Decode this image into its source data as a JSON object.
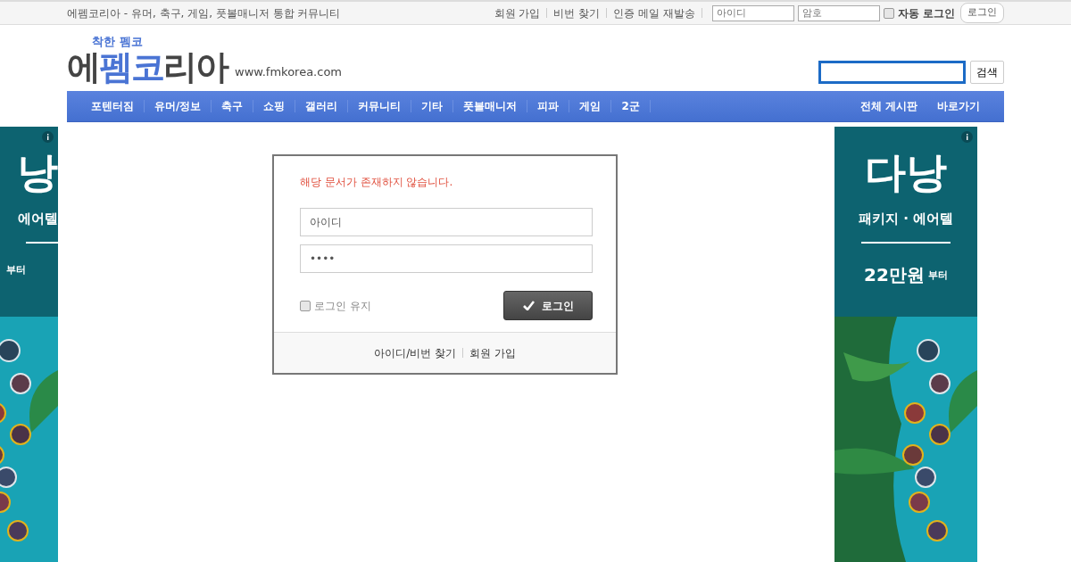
{
  "top_bar": {
    "description": "에펨코리아 - 유머, 축구, 게임, 풋볼매니저 통합 커뮤니티",
    "links": [
      "회원 가입",
      "비번 찾기",
      "인증 메일 재발송"
    ],
    "id_field": {
      "placeholder": "아이디"
    },
    "password_field": {
      "placeholder": "암호"
    },
    "auto_login": {
      "label": "자동 로그인",
      "checked": false
    },
    "login_button": "로그인"
  },
  "logo": {
    "tagline": "착한 펨코",
    "name": [
      {
        "text": "에",
        "highlight": false
      },
      {
        "text": "펨코",
        "highlight": true
      },
      {
        "text": "리아",
        "highlight": false
      }
    ],
    "url": "www.fmkorea.com"
  },
  "search": {
    "button": "검색"
  },
  "nav": {
    "items": [
      "포텐터짐",
      "유머/정보",
      "축구",
      "쇼핑",
      "갤러리",
      "커뮤니티",
      "기타",
      "풋볼매니저",
      "피파",
      "게임",
      "2군"
    ],
    "right_items": [
      "전체 게시판",
      "바로가기"
    ]
  },
  "ads": [
    {
      "title": "낭",
      "subtitle": "에어텔",
      "suffix": "부터"
    },
    {
      "title": "다낭",
      "subtitle": "패키지 · 에어텔",
      "price": "22만원",
      "suffix": "부터"
    }
  ],
  "login_box": {
    "message": "해당 문서가 존재하지 않습니다.",
    "id_field": {
      "placeholder": "아이디"
    },
    "password_field": {
      "placeholder": "••••"
    },
    "keep_login": {
      "label": "로그인 유지",
      "checked": false
    },
    "login_button": "로그인",
    "footer_links": [
      "아이디/비번 찾기",
      "회원 가입"
    ]
  }
}
